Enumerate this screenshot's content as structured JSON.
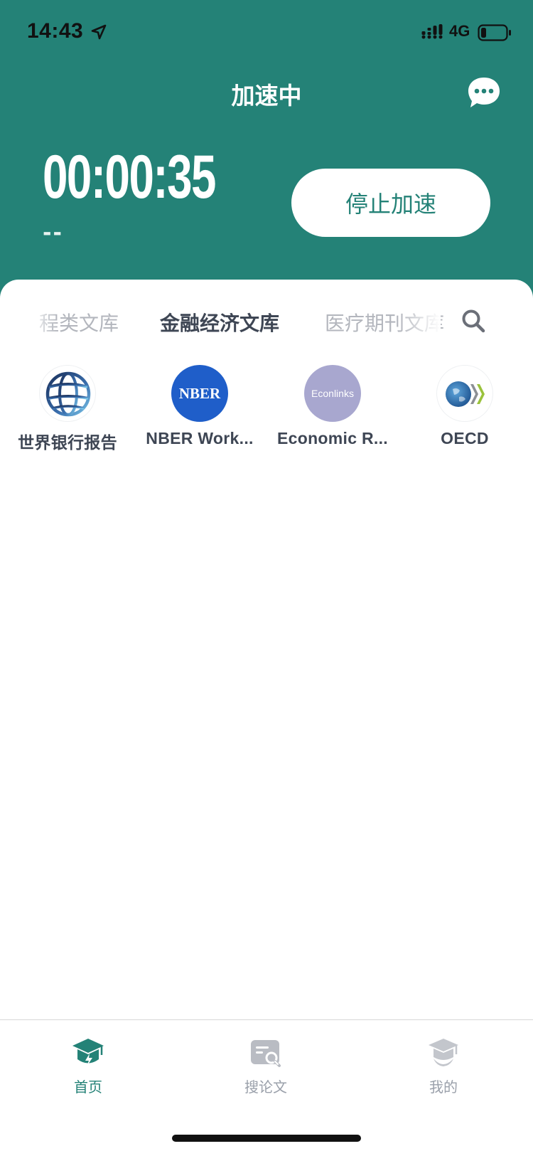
{
  "status_bar": {
    "time": "14:43",
    "network": "4G"
  },
  "header": {
    "title": "加速中",
    "timer": "00:00:35",
    "sub_status": "--",
    "stop_button_label": "停止加速"
  },
  "tabs": [
    {
      "label": "程类文库"
    },
    {
      "label": "金融经济文库",
      "active": true
    },
    {
      "label": "医疗期刊文库"
    }
  ],
  "libraries": [
    {
      "label": "世界银行报告"
    },
    {
      "label": "NBER Work...",
      "logo_text": "NBER"
    },
    {
      "label": "Economic R...",
      "logo_text": "Econlinks"
    },
    {
      "label": "OECD"
    }
  ],
  "tabbar": {
    "items": [
      {
        "label": "首页",
        "active": true
      },
      {
        "label": "搜论文"
      },
      {
        "label": "我的"
      }
    ]
  },
  "colors": {
    "brand": "#248277",
    "active_text": "#3e4654",
    "inactive_tab": "#b3b6bd",
    "tabbar_inactive": "#9aa0aa"
  }
}
